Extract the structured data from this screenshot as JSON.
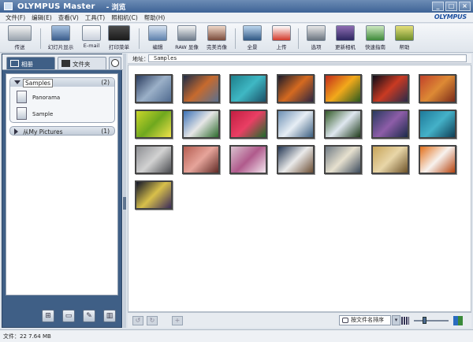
{
  "window": {
    "app_title": "OLYMPUS Master",
    "sub_title": "- 浏览",
    "minimize_label": "_",
    "maximize_label": "□",
    "close_label": "×"
  },
  "menubar": {
    "items": [
      "文件(F)",
      "编辑(E)",
      "查看(V)",
      "工具(T)",
      "照相机(C)",
      "帮助(H)"
    ],
    "logo": "OLYMPUS"
  },
  "toolbar": {
    "items": [
      {
        "label": "传送",
        "icon": "camera-transfer-icon"
      },
      {
        "label": "幻灯片显示",
        "icon": "slideshow-icon"
      },
      {
        "label": "E-mail",
        "icon": "email-icon"
      },
      {
        "label": "打印菜单",
        "icon": "printer-icon"
      },
      {
        "label": "编辑",
        "icon": "edit-image-icon"
      },
      {
        "label": "RAW 显像",
        "icon": "raw-develop-icon"
      },
      {
        "label": "完美肖像",
        "icon": "perfect-portrait-icon"
      },
      {
        "label": "全景",
        "icon": "panorama-icon"
      },
      {
        "label": "上传",
        "icon": "youtube-upload-icon"
      },
      {
        "label": "选项",
        "icon": "options-tools-icon"
      },
      {
        "label": "更新相机",
        "icon": "update-camera-icon"
      },
      {
        "label": "快速指南",
        "icon": "quick-guide-icon"
      },
      {
        "label": "帮助",
        "icon": "help-icon"
      }
    ]
  },
  "left_panel": {
    "tabs": [
      {
        "label": "相册",
        "icon": "album-icon"
      },
      {
        "label": "文件夹",
        "icon": "folder-icon"
      },
      {
        "label": "",
        "icon": "clock-icon"
      }
    ],
    "group1": {
      "name": "Samples",
      "count": "(2)"
    },
    "albums": [
      {
        "label": "Panorama"
      },
      {
        "label": "Sample"
      }
    ],
    "group2": {
      "name": "从My Pictures",
      "count": "(1)"
    },
    "buttons": [
      "new-album-icon",
      "album-properties-icon",
      "rename-icon",
      "delete-album-icon"
    ]
  },
  "address": {
    "label": "地址：",
    "value": "Samples"
  },
  "thumbnails": [
    {
      "colors": [
        "#2a3c5e",
        "#9bb0c8",
        "#4f6a8f"
      ]
    },
    {
      "colors": [
        "#1e2c46",
        "#c66a2e",
        "#5a708f"
      ]
    },
    {
      "colors": [
        "#1d7f8b",
        "#3fb8c4",
        "#1a4f66"
      ]
    },
    {
      "colors": [
        "#1a1a2a",
        "#d56a20",
        "#2e2540"
      ]
    },
    {
      "colors": [
        "#c22b1b",
        "#f2a91b",
        "#2a5a1f"
      ]
    },
    {
      "colors": [
        "#0c0c18",
        "#c93a22",
        "#2a2a4a"
      ]
    },
    {
      "colors": [
        "#c1422a",
        "#dd8a35",
        "#7a2a1a"
      ]
    },
    {
      "colors": [
        "#c9d52a",
        "#6fa81e",
        "#f0e24a"
      ]
    },
    {
      "colors": [
        "#3b72b7",
        "#e6e6e6",
        "#2c6a2c"
      ]
    },
    {
      "colors": [
        "#c21e42",
        "#e93f64",
        "#1d6b2a"
      ]
    },
    {
      "colors": [
        "#6c8fb3",
        "#e7eef5",
        "#3c5f80"
      ]
    },
    {
      "colors": [
        "#355c2a",
        "#dfe8f0",
        "#1e3a1a"
      ]
    },
    {
      "colors": [
        "#293a60",
        "#8d5da8",
        "#1b2a4a"
      ]
    },
    {
      "colors": [
        "#1e7a9a",
        "#44b1c8",
        "#0f3e55"
      ]
    },
    {
      "colors": [
        "#8d8f93",
        "#d2d2d2",
        "#4a4c50"
      ]
    },
    {
      "colors": [
        "#b55e52",
        "#e6a49a",
        "#5f2a26"
      ]
    },
    {
      "colors": [
        "#d9c2cf",
        "#b05a8c",
        "#f3e6ee"
      ]
    },
    {
      "colors": [
        "#223552",
        "#eaeaea",
        "#6b4d33"
      ]
    },
    {
      "colors": [
        "#6f7a84",
        "#e7e1cf",
        "#3b4a5c"
      ]
    },
    {
      "colors": [
        "#c7a45a",
        "#e8d6a8",
        "#6d5228"
      ]
    },
    {
      "colors": [
        "#e26f1a",
        "#f7f2ee",
        "#b5420d"
      ]
    },
    {
      "colors": [
        "#101428",
        "#d8c04a",
        "#3a2a5a"
      ]
    }
  ],
  "bottom_bar": {
    "sort_label": "按文件名排序",
    "buttons": [
      "rotate-left-icon",
      "rotate-right-icon",
      "add-to-album-icon"
    ]
  },
  "status": {
    "text": "文件：22 7.64 MB"
  }
}
